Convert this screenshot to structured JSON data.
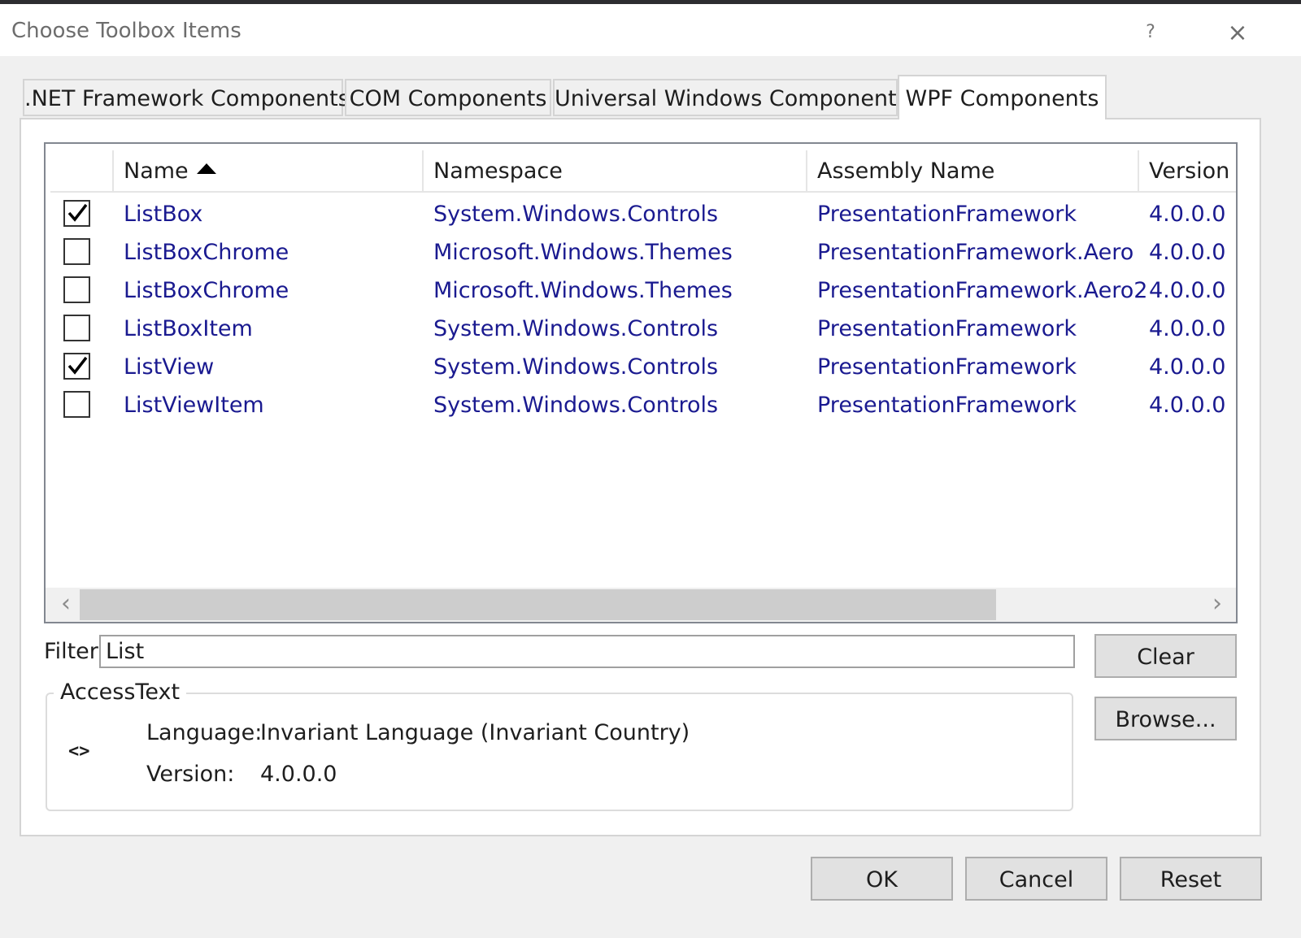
{
  "window": {
    "title": "Choose Toolbox Items",
    "help": "?",
    "close": "×"
  },
  "tabs": [
    {
      "label": ".NET Framework Components"
    },
    {
      "label": "COM Components"
    },
    {
      "label": "Universal Windows Components"
    },
    {
      "label": "WPF Components",
      "active": true
    }
  ],
  "list": {
    "columns": [
      "Name",
      "Namespace",
      "Assembly Name",
      "Version"
    ],
    "sort_column": "Name",
    "sort_direction": "ascending",
    "rows": [
      {
        "checked": true,
        "name": "ListBox",
        "namespace": "System.Windows.Controls",
        "assembly": "PresentationFramework",
        "version": "4.0.0.0"
      },
      {
        "checked": false,
        "name": "ListBoxChrome",
        "namespace": "Microsoft.Windows.Themes",
        "assembly": "PresentationFramework.Aero",
        "version": "4.0.0.0"
      },
      {
        "checked": false,
        "name": "ListBoxChrome",
        "namespace": "Microsoft.Windows.Themes",
        "assembly": "PresentationFramework.Aero2",
        "version": "4.0.0.0"
      },
      {
        "checked": false,
        "name": "ListBoxItem",
        "namespace": "System.Windows.Controls",
        "assembly": "PresentationFramework",
        "version": "4.0.0.0"
      },
      {
        "checked": true,
        "name": "ListView",
        "namespace": "System.Windows.Controls",
        "assembly": "PresentationFramework",
        "version": "4.0.0.0"
      },
      {
        "checked": false,
        "name": "ListViewItem",
        "namespace": "System.Windows.Controls",
        "assembly": "PresentationFramework",
        "version": "4.0.0.0"
      }
    ],
    "scroll_left_glyph": "‹",
    "scroll_right_glyph": "›"
  },
  "filter": {
    "label": "Filter:",
    "value": "List"
  },
  "buttons": {
    "clear": "Clear",
    "browse": "Browse...",
    "ok": "OK",
    "cancel": "Cancel",
    "reset": "Reset"
  },
  "details": {
    "group_title": "AccessText",
    "icon": "code-brackets-icon",
    "language_label": "Language:",
    "language_value": "Invariant Language (Invariant Country)",
    "version_label": "Version:",
    "version_value": "4.0.0.0"
  },
  "colors": {
    "link_text": "#1a1a90",
    "scroll_thumb": "#cdcdcd",
    "dialog_bg": "#f0f0f0"
  }
}
